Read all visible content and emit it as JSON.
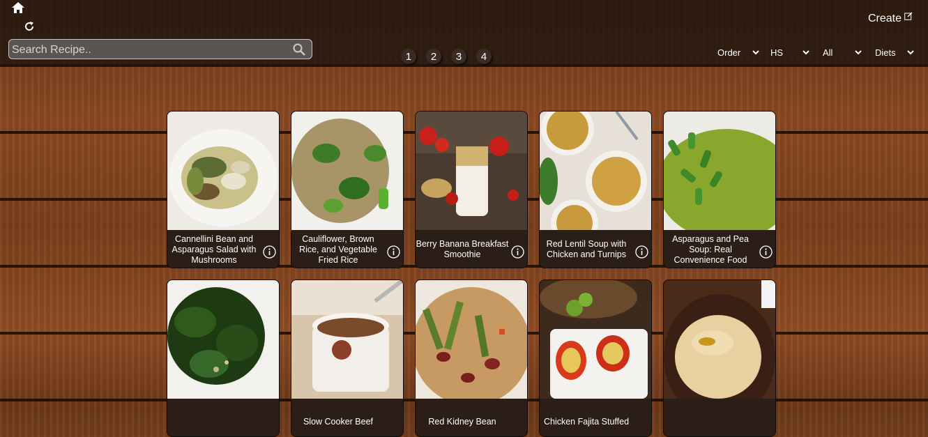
{
  "header": {
    "search_placeholder": "Search Recipe..",
    "create_label": "Create",
    "pages": [
      "1",
      "2",
      "3",
      "4"
    ],
    "filters": [
      {
        "label": "Order"
      },
      {
        "label": "HS"
      },
      {
        "label": "All"
      },
      {
        "label": "Diets"
      }
    ]
  },
  "recipes": [
    {
      "title": "Cannellini Bean and Asparagus Salad with Mushrooms"
    },
    {
      "title": "Cauliflower, Brown Rice, and Vegetable Fried Rice"
    },
    {
      "title": "Berry Banana Breakfast Smoothie"
    },
    {
      "title": "Red Lentil Soup with Chicken and Turnips"
    },
    {
      "title": "Asparagus and Pea Soup: Real Convenience Food"
    },
    {
      "title": ""
    },
    {
      "title": "Slow Cooker Beef"
    },
    {
      "title": "Red Kidney Bean"
    },
    {
      "title": "Chicken Fajita Stuffed"
    },
    {
      "title": ""
    }
  ],
  "colors": {
    "topbar": "#1e140e",
    "card_caption": "#2b1e16"
  }
}
